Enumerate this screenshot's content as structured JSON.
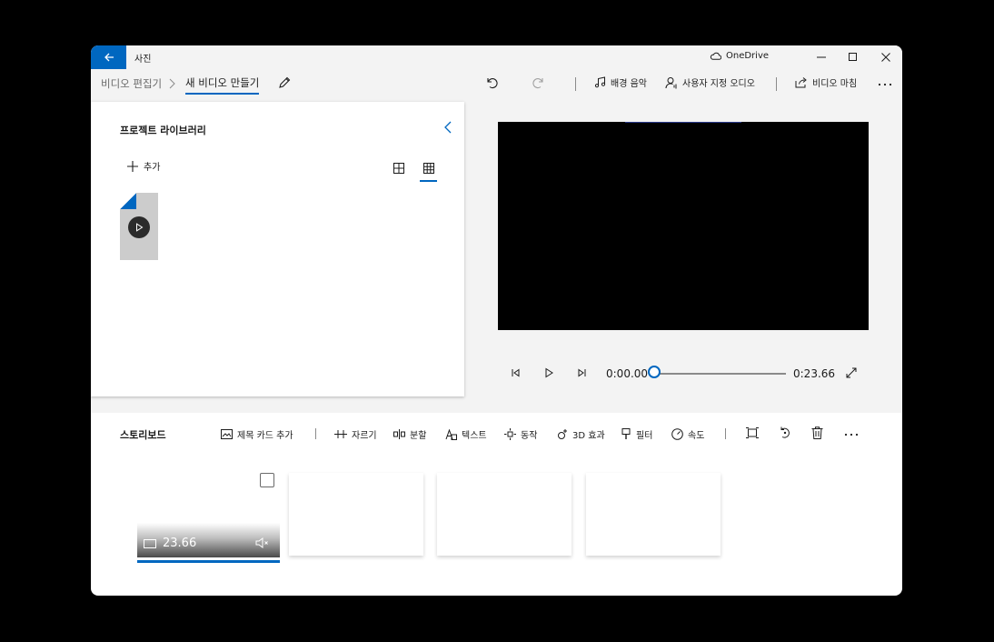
{
  "titlebar": {
    "app_title": "사진",
    "onedrive_label": "OneDrive"
  },
  "breadcrumb": {
    "parent": "비디오 편집기",
    "current": "새 비디오 만들기"
  },
  "toolbar": {
    "background_music": "배경 음악",
    "custom_audio": "사용자 지정 오디오",
    "finish_video": "비디오 마침"
  },
  "library": {
    "title": "프로젝트 라이브러리",
    "add_label": "추가"
  },
  "player": {
    "current_time": "0:00.00",
    "total_time": "0:23.66",
    "progress": 0
  },
  "storyboard": {
    "title": "스토리보드",
    "add_title_card": "제목 카드 추가",
    "trim": "자르기",
    "split": "분할",
    "text": "텍스트",
    "motion": "동작",
    "effects_3d": "3D 효과",
    "filters": "필터",
    "speed": "속도",
    "clip_duration": "23.66"
  },
  "colors": {
    "accent": "#0067c0",
    "background": "#f3f3f3"
  }
}
